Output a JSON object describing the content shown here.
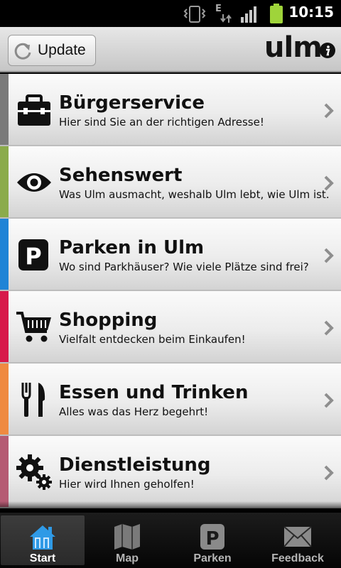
{
  "status_bar": {
    "time": "10:15",
    "network_label": "E",
    "icons": [
      "vibrate-icon",
      "network-e-icon",
      "signal-icon",
      "battery-icon"
    ]
  },
  "header": {
    "update_label": "Update",
    "logo_text": "ulm",
    "info_icon": "info-icon"
  },
  "menu": {
    "items": [
      {
        "title": "Bürgerservice",
        "description": "Hier sind Sie an der richtigen Adresse!",
        "color": "#7a7a7a",
        "icon": "briefcase-icon"
      },
      {
        "title": "Sehenswert",
        "description": "Was Ulm ausmacht, weshalb Ulm lebt, wie Ulm ist.",
        "color": "#8bab4b",
        "icon": "eye-icon"
      },
      {
        "title": "Parken in Ulm",
        "description": "Wo sind Parkhäuser? Wie viele Plätze sind frei?",
        "color": "#1f84d6",
        "icon": "parking-icon"
      },
      {
        "title": "Shopping",
        "description": "Vielfalt entdecken beim Einkaufen!",
        "color": "#d7194a",
        "icon": "cart-icon"
      },
      {
        "title": "Essen und Trinken",
        "description": "Alles was das Herz begehrt!",
        "color": "#ef8a40",
        "icon": "fork-knife-icon"
      },
      {
        "title": "Dienstleistung",
        "description": "Hier wird Ihnen geholfen!",
        "color": "#b55b73",
        "icon": "gears-icon"
      }
    ]
  },
  "tabbar": {
    "tabs": [
      {
        "label": "Start",
        "icon": "home-icon",
        "active": true
      },
      {
        "label": "Map",
        "icon": "map-icon",
        "active": false
      },
      {
        "label": "Parken",
        "icon": "parking-icon",
        "active": false
      },
      {
        "label": "Feedback",
        "icon": "mail-icon",
        "active": false
      }
    ]
  }
}
